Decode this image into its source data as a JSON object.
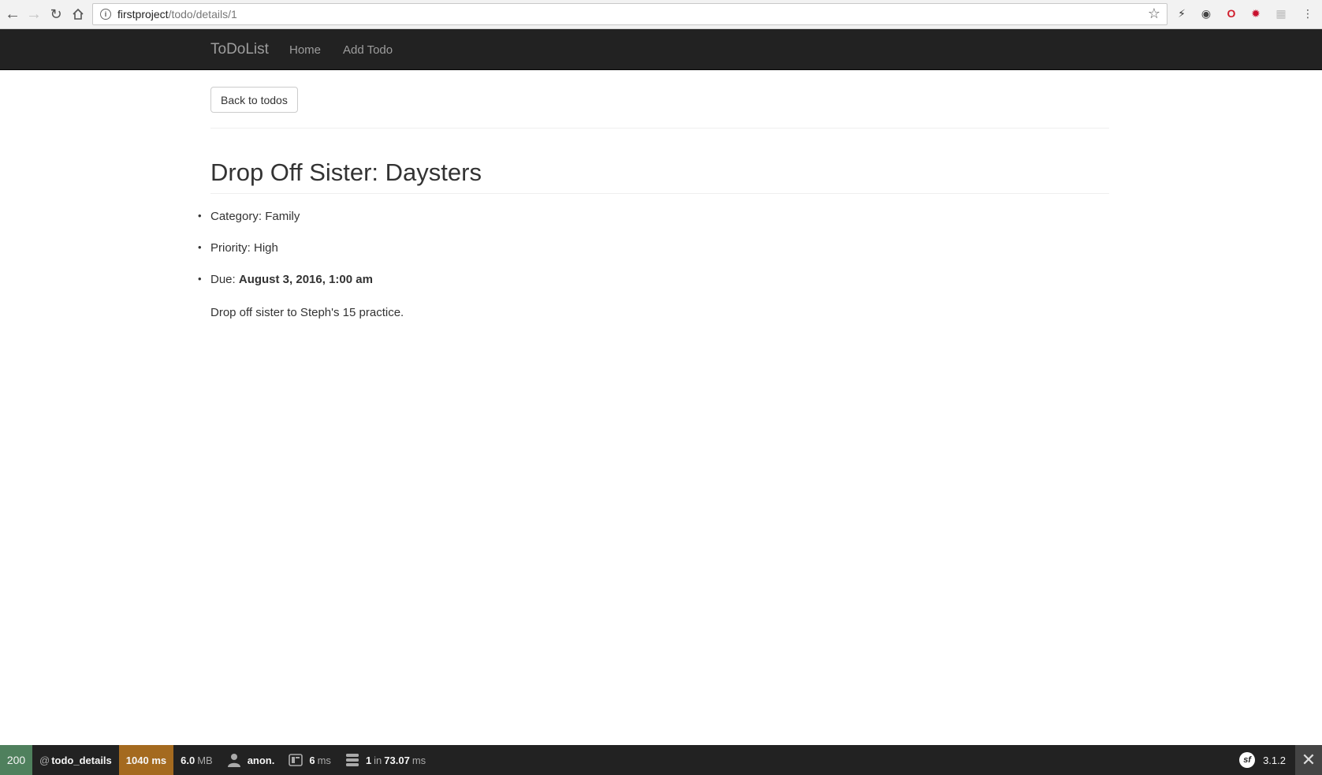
{
  "browser": {
    "url_host": "firstproject",
    "url_path": "/todo/details/1"
  },
  "navbar": {
    "brand": "ToDoList",
    "links": [
      "Home",
      "Add Todo"
    ]
  },
  "content": {
    "back_button": "Back to todos",
    "title": "Drop Off Sister: Daysters",
    "category_label": "Category: ",
    "category_value": "Family",
    "priority_label": "Priority: ",
    "priority_value": "High",
    "due_label": "Due: ",
    "due_value": "August 3, 2016, 1:00 am",
    "description": "Drop off sister to Steph's 15 practice."
  },
  "toolbar": {
    "status": "200",
    "route_prefix": "@",
    "route": "todo_details",
    "time": "1040 ms",
    "memory_value": "6.0",
    "memory_unit": "MB",
    "user": "anon.",
    "render_value": "6",
    "render_unit": "ms",
    "db_count": "1",
    "db_in": "in",
    "db_time": "73.07",
    "db_unit": "ms",
    "version": "3.1.2",
    "colors": {
      "status_ok": "#4f805d",
      "time_warning": "#a46a1f"
    }
  }
}
